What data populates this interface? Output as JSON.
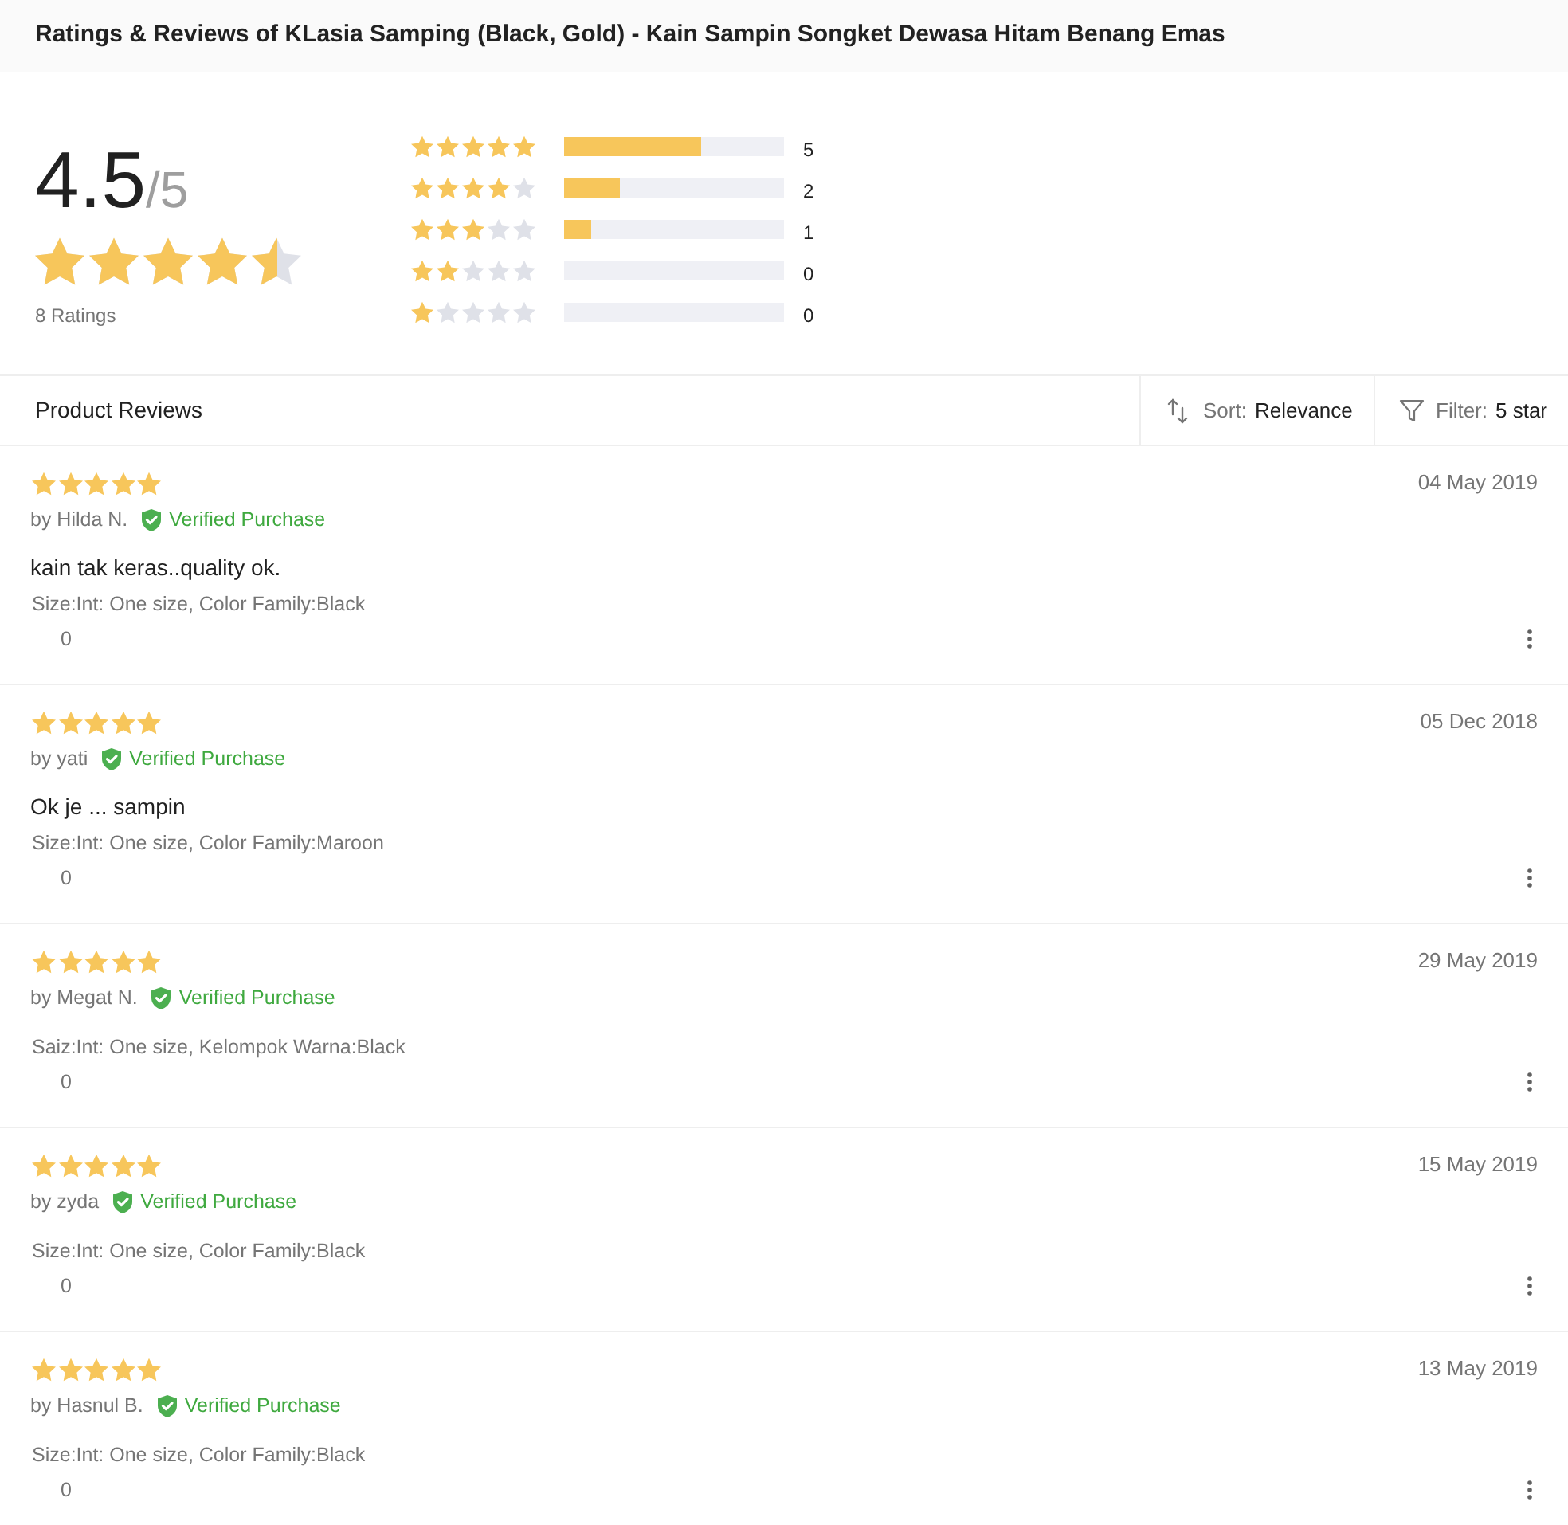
{
  "header": {
    "title": "Ratings & Reviews of KLasia Samping (Black, Gold) - Kain Sampin Songket Dewasa Hitam Benang Emas"
  },
  "summary": {
    "score": "4.5",
    "out_of": "/5",
    "stars": 4.5,
    "ratings_count": "8 Ratings"
  },
  "histogram": [
    {
      "stars": 5,
      "level": 0.625,
      "count": "5"
    },
    {
      "stars": 4,
      "level": 0.25,
      "count": "2"
    },
    {
      "stars": 3,
      "level": 0.125,
      "count": "1"
    },
    {
      "stars": 2,
      "count": "0"
    },
    {
      "stars": 1,
      "count": "0"
    }
  ],
  "reviews_bar": {
    "title": "Product Reviews",
    "sort": {
      "label": "Sort:",
      "value": "Relevance"
    },
    "filter": {
      "label": "Filter:",
      "value": "5 star"
    }
  },
  "reviews": [
    {
      "stars": 5,
      "author": "by Hilda N.",
      "badge": "Verified Purchase",
      "date": "04 May 2019",
      "content": "kain tak keras..quality ok.",
      "sku": "Size:Int: One size, Color Family:Black",
      "likes": "0"
    },
    {
      "stars": 5,
      "author": "by yati",
      "badge": "Verified Purchase",
      "date": "05 Dec 2018",
      "content": "Ok je ... sampin",
      "sku": "Size:Int: One size, Color Family:Maroon",
      "likes": "0"
    },
    {
      "stars": 5,
      "author": "by Megat N.",
      "badge": "Verified Purchase",
      "date": "29 May 2019",
      "sku": "Saiz:Int: One size, Kelompok Warna:Black",
      "likes": "0"
    },
    {
      "stars": 5,
      "author": "by zyda",
      "badge": "Verified Purchase",
      "date": "15 May 2019",
      "sku": "Size:Int: One size, Color Family:Black",
      "likes": "0"
    },
    {
      "stars": 5,
      "author": "by Hasnul B.",
      "badge": "Verified Purchase",
      "date": "13 May 2019",
      "sku": "Size:Int: One size, Color Family:Black",
      "likes": "0"
    }
  ]
}
